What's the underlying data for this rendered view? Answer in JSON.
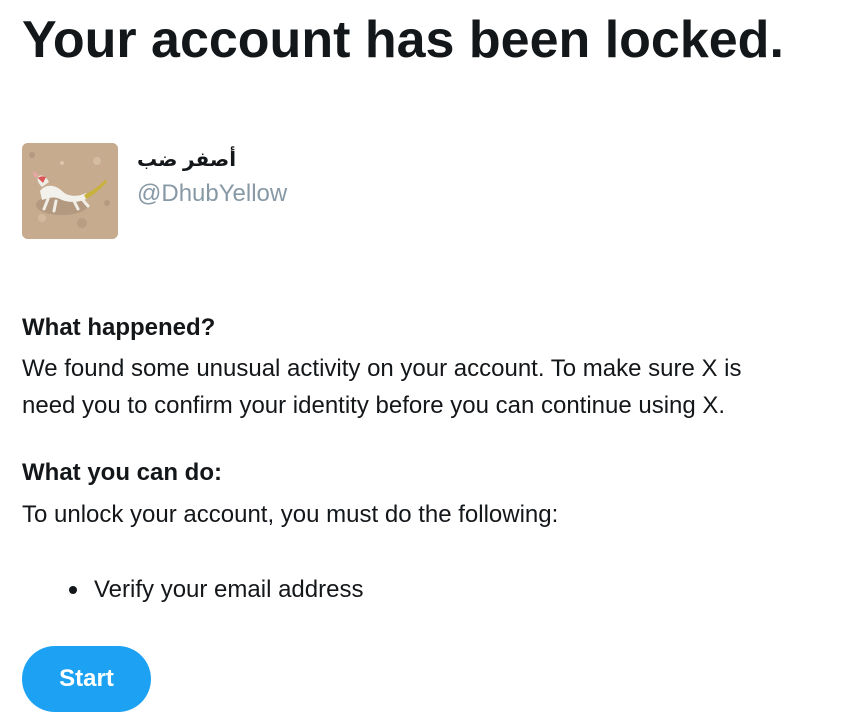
{
  "page": {
    "title": "Your account has been locked."
  },
  "profile": {
    "display_name": "أصفر ضب",
    "handle": "@DhubYellow",
    "avatar_icon": "lizard-photo-avatar"
  },
  "what_happened": {
    "heading": "What happened?",
    "lines": [
      "We found some unusual activity on your account. To make sure X is",
      "need you to confirm your identity before you can continue using X."
    ]
  },
  "what_you_can_do": {
    "heading": "What you can do:",
    "text": "To unlock your account, you must do the following:",
    "steps": [
      "Verify your email address"
    ]
  },
  "actions": {
    "start_label": "Start"
  },
  "colors": {
    "primary": "#1da1f2",
    "text": "#14171a",
    "muted": "#8899a6"
  }
}
